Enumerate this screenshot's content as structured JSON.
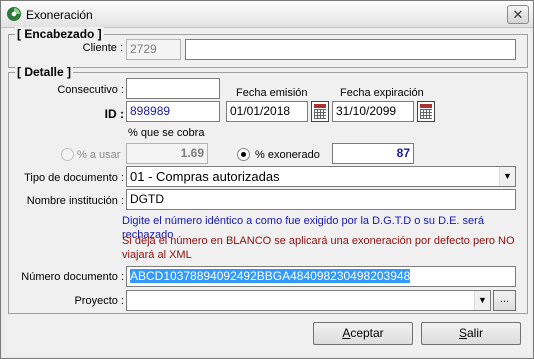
{
  "window": {
    "title": "Exoneración",
    "close_label": "✕"
  },
  "encabezado": {
    "legend": "[ Encabezado ]",
    "cliente_label": "Cliente :",
    "cliente_code": "2729",
    "cliente_name": ""
  },
  "detalle": {
    "legend": "[ Detalle ]",
    "consecutivo_label": "Consecutivo :",
    "consecutivo_value": "",
    "fecha_emision_label": "Fecha emisión",
    "fecha_expiracion_label": "Fecha expiración",
    "id_label": "ID :",
    "id_value": "898989",
    "fecha_emision_value": "01/01/2018",
    "fecha_expiracion_value": "31/10/2099",
    "porcentaje_cobra_label": "% que se cobra",
    "porcentaje_usar_label": "% a usar",
    "porcentaje_usar_value": "1.69",
    "porcentaje_exonerado_label": "% exonerado",
    "porcentaje_exonerado_value": "87",
    "selected_radio": "exonerado",
    "tipo_documento_label": "Tipo de documento :",
    "tipo_documento_value": "01 - Compras autorizadas",
    "nombre_institucion_label": "Nombre institución :",
    "nombre_institucion_value": "DGTD",
    "msg_blue": "Digite el número idéntico a como fue exigido por la D.G.T.D o su D.E. será rechazado",
    "msg_red_line1": "Si deja el número en BLANCO se aplicará una exoneración por defecto pero NO",
    "msg_red_line2": "viajará al XML",
    "numero_documento_label": "Número documento :",
    "numero_documento_value": "ABCD10378894092492BBGA484098230498203948",
    "proyecto_label": "Proyecto :",
    "proyecto_value": "",
    "proyecto_browse_label": "..."
  },
  "buttons": {
    "aceptar_mnemonic": "A",
    "aceptar_rest": "ceptar",
    "salir_mnemonic": "S",
    "salir_rest": "alir"
  },
  "colors": {
    "selection": "#3399ff",
    "info_blue": "#1717b0",
    "warning_red": "#8b1010"
  }
}
